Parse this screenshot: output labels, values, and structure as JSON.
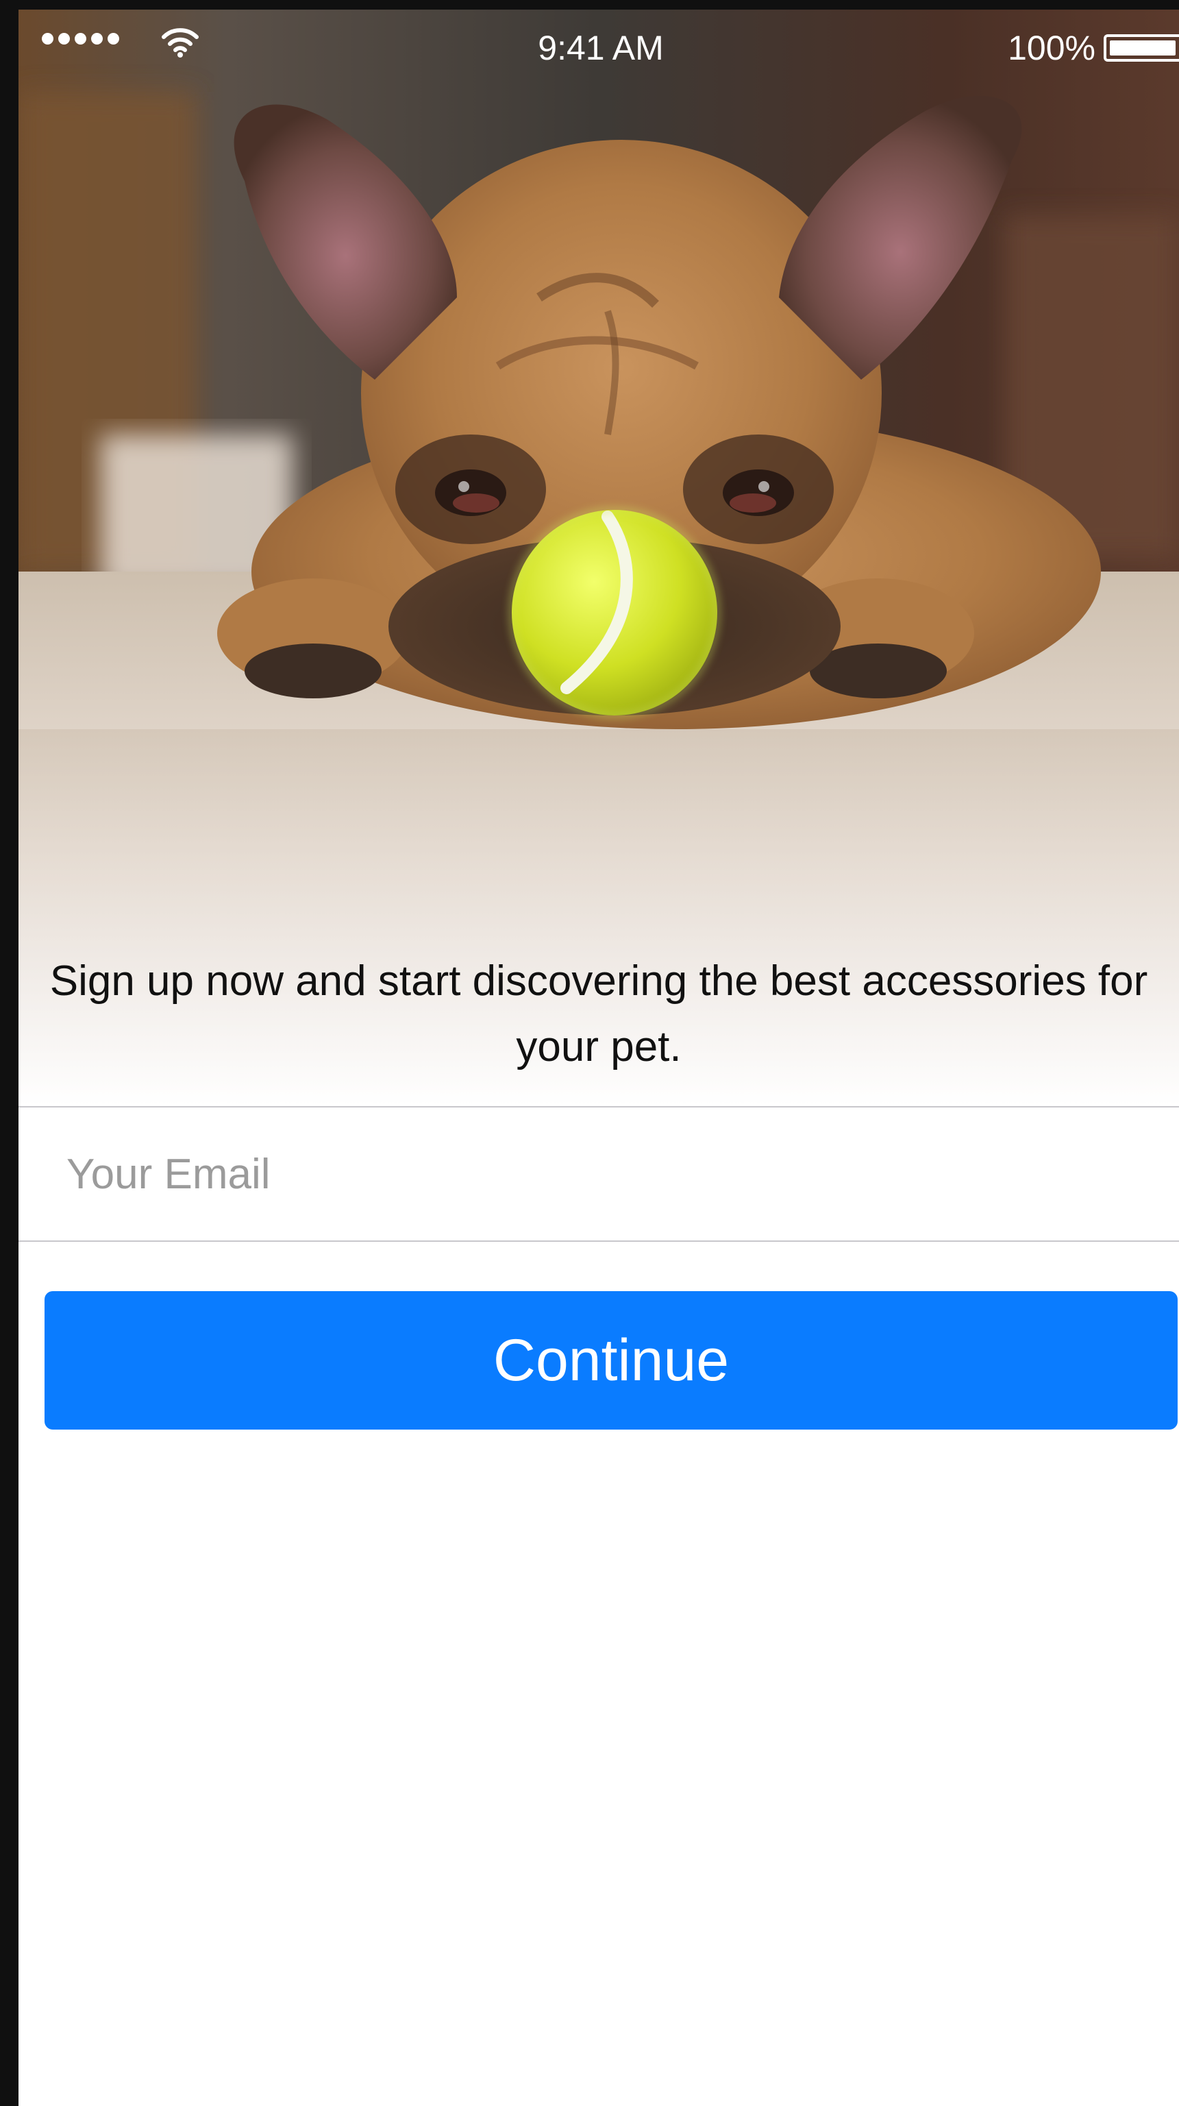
{
  "status_bar": {
    "time": "9:41 AM",
    "battery_percent": "100%",
    "signal_bars": 5,
    "icons": [
      "signal-dots-icon",
      "wifi-icon",
      "battery-icon"
    ]
  },
  "hero": {
    "image": "dog-with-tennis-ball-photo"
  },
  "signup": {
    "tagline": "Sign up now and start discovering the best accessories for your pet.",
    "email_placeholder": "Your Email",
    "email_value": "",
    "continue_label": "Continue"
  },
  "colors": {
    "accent": "#0a7cff",
    "separator": "#c8c7cc",
    "placeholder": "#9b9b9b",
    "device_frame": "#101010"
  }
}
